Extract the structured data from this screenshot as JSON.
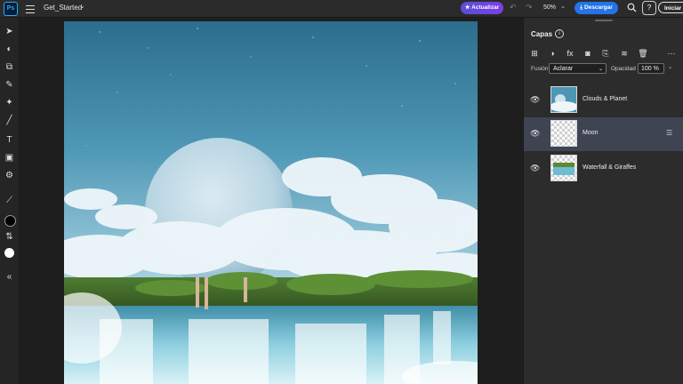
{
  "app": {
    "logo": "Ps",
    "document_name": "Get_Started"
  },
  "header": {
    "update_label": "Actualizar",
    "zoom": "50%",
    "download_label": "Descargar",
    "help_label": "?",
    "signin_label": "Iniciar se"
  },
  "toolbar": {
    "tools": [
      "move-tool",
      "selection-tool",
      "crop-tool",
      "brush-retouch-tool",
      "healing-tool",
      "brush-tool",
      "type-tool",
      "shape-tool",
      "adjustment-tool",
      "eyedropper-tool",
      "swap-colors",
      "foreground-color",
      "background-color",
      "collapse-toolbar"
    ],
    "foreground_color": "#000000",
    "background_color": "#ffffff"
  },
  "layers_panel": {
    "title": "Capas",
    "blend_label": "Fusión",
    "blend_mode": "Aclarar",
    "opacity_label": "Opacidad",
    "opacity_value": "100 %",
    "layers": [
      {
        "name": "Clouds & Planet",
        "visible": true,
        "selected": false
      },
      {
        "name": "Moon",
        "visible": true,
        "selected": true
      },
      {
        "name": "Waterfall & Giraffes",
        "visible": true,
        "selected": false
      }
    ]
  },
  "colors": {
    "accent_update": "#6a46e0",
    "accent_download": "#2473e8",
    "selected_layer": "#3e4452"
  }
}
